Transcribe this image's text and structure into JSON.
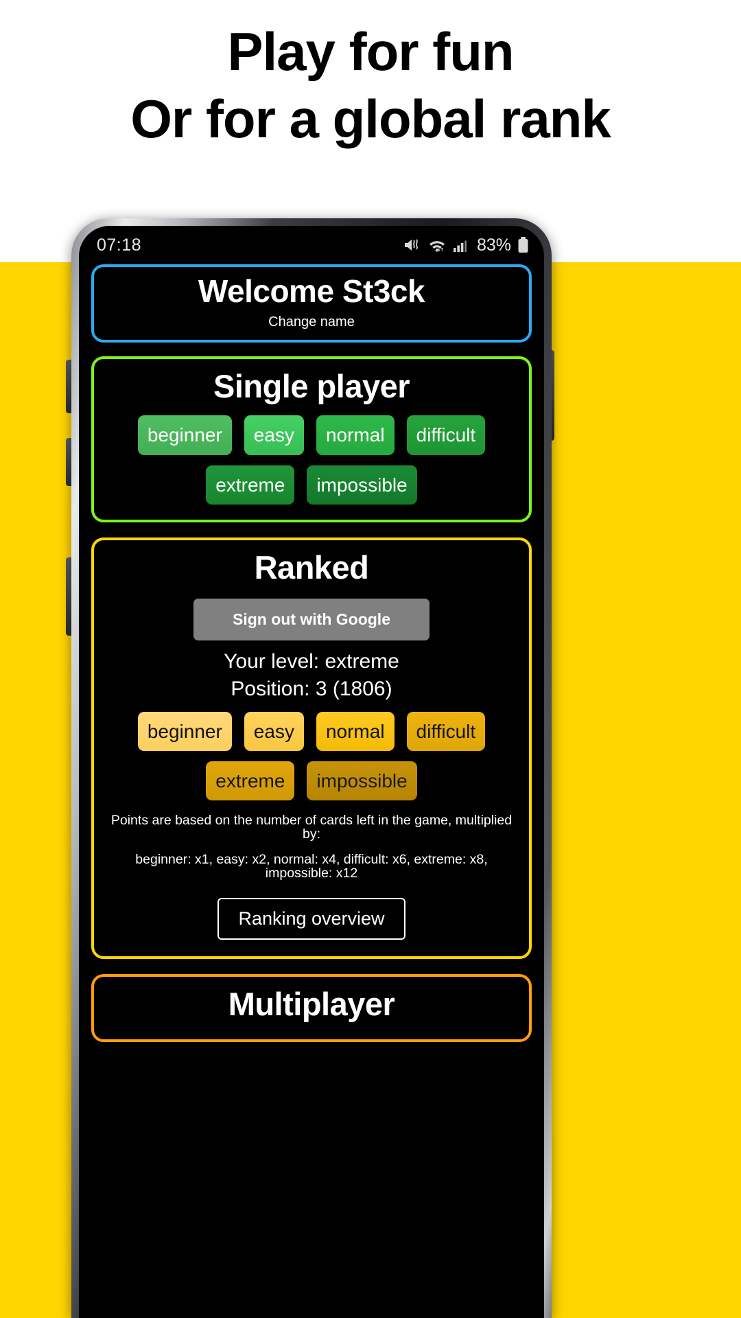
{
  "promo": {
    "line1": "Play for fun",
    "line2": "Or for a global rank"
  },
  "statusbar": {
    "time": "07:18",
    "battery_text": "83%",
    "icons": [
      "volume-mute-vibrate-icon",
      "wifi-icon",
      "cellular-signal-icon",
      "battery-icon"
    ]
  },
  "welcome": {
    "title": "Welcome St3ck",
    "change_name": "Change name"
  },
  "single_player": {
    "title": "Single player",
    "buttons_row1": [
      "beginner",
      "easy",
      "normal",
      "difficult"
    ],
    "buttons_row2": [
      "extreme",
      "impossible"
    ]
  },
  "ranked": {
    "title": "Ranked",
    "google_button": "Sign out with Google",
    "your_level": "Your level: extreme",
    "position": "Position: 3 (1806)",
    "buttons_row1": [
      "beginner",
      "easy",
      "normal",
      "difficult"
    ],
    "buttons_row2": [
      "extreme",
      "impossible"
    ],
    "note_line1": "Points are based on the number of cards left in the game, multiplied by:",
    "note_line2": "beginner: x1, easy: x2, normal: x4, difficult: x6, extreme: x8, impossible: x12",
    "overview_button": "Ranking overview"
  },
  "multiplayer": {
    "title": "Multiplayer"
  },
  "colors": {
    "page_background": "#FFD500",
    "screen_background": "#000000",
    "welcome_border": "#29A9F2",
    "single_border": "#7CF21E",
    "ranked_border": "#FFD600",
    "multiplayer_border": "#FF9D0B",
    "google_button": "#808080"
  }
}
